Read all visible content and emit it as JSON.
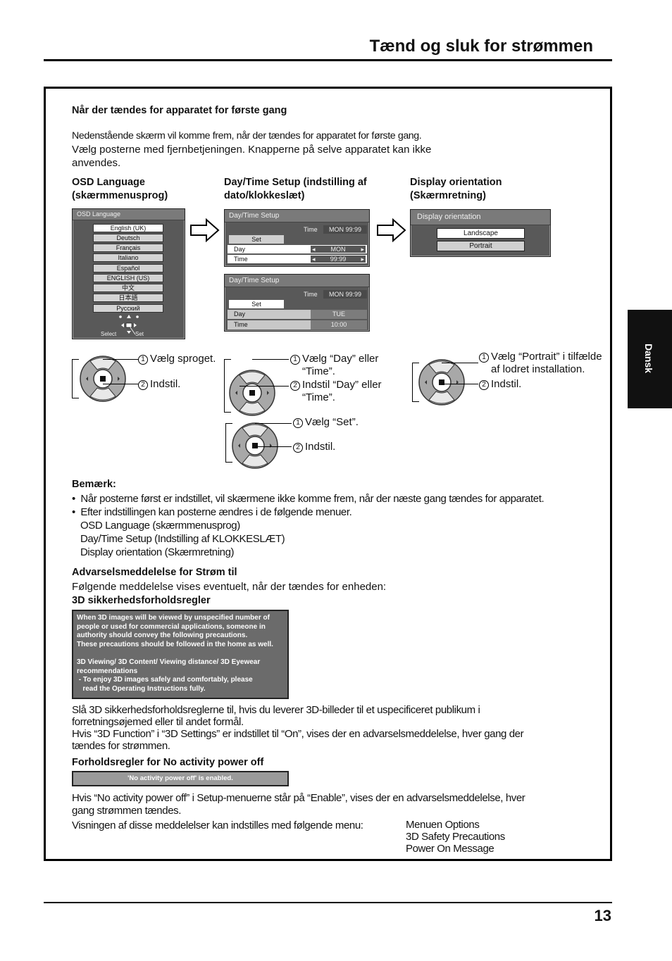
{
  "header": {
    "title": "Tænd og sluk for strømmen"
  },
  "side_tab": {
    "label": "Dansk"
  },
  "page_number": "13",
  "first_power_on": {
    "heading": "Når der tændes for apparatet for første gang",
    "intro_line1": "Nedenstående skærm vil komme frem, når der tændes for apparatet for første gang.",
    "intro_line2": "Vælg posterne med fjernbetjeningen. Knapperne på selve apparatet kan ikke",
    "intro_line3": "anvendes.",
    "columns": [
      {
        "title_line1": "OSD Language",
        "title_line2": "(skærmmenusprog)"
      },
      {
        "title_line1": "Day/Time Setup (indstilling af",
        "title_line2": "dato/klokkeslæt)"
      },
      {
        "title_line1": "Display orientation",
        "title_line2": "(Skærmretning)"
      }
    ]
  },
  "osd_language_screen": {
    "title": "OSD Language",
    "languages": [
      "English (UK)",
      "Deutsch",
      "Français",
      "Italiano",
      "Español",
      "ENGLISH (US)",
      "中文",
      "日本語",
      "Русский"
    ],
    "selected": "English (UK)",
    "select_label": "Select",
    "set_label": "Set"
  },
  "daytime_screen_1": {
    "title": "Day/Time Setup",
    "time_label": "Time",
    "time_value": "MON  99:99",
    "set_label": "Set",
    "day_label": "Day",
    "day_value": "MON",
    "time_row_label": "Time",
    "time_row_value": "99:99"
  },
  "daytime_screen_2": {
    "title": "Day/Time Setup",
    "time_label": "Time",
    "time_value": "MON  99:99",
    "set_label": "Set",
    "day_label": "Day",
    "day_value": "TUE",
    "time_row_label": "Time",
    "time_row_value": "10:00"
  },
  "orientation_screen": {
    "title": "Display orientation",
    "options": [
      "Landscape",
      "Portrait"
    ],
    "selected": "Landscape"
  },
  "instructions": {
    "osd": {
      "step1": "Vælg sproget.",
      "step2": "Indstil."
    },
    "daytime_a": {
      "step1_l1": "Vælg “Day” eller",
      "step1_l2": "“Time”.",
      "step2_l1": "Indstil “Day” eller",
      "step2_l2": "“Time”."
    },
    "daytime_b": {
      "step1": "Vælg “Set”.",
      "step2": "Indstil."
    },
    "orientation": {
      "step1_l1": "Vælg “Portrait” i tilfælde",
      "step1_l2": "af lodret installation.",
      "step2": "Indstil."
    },
    "num1": "1",
    "num2": "2"
  },
  "note": {
    "heading": "Bemærk:",
    "bullet1": "Når posterne først er indstillet, vil skærmene ikke komme frem, når der næste gang tændes for apparatet.",
    "bullet2": "Efter indstillingen kan posterne ændres i de følgende menuer.",
    "menu1": "OSD Language (skærmmenusprog)",
    "menu2": "Day/Time Setup (Indstilling af KLOKKESLÆT)",
    "menu3": "Display orientation (Skærmretning)"
  },
  "warning": {
    "heading": "Advarselsmeddelelse for Strøm til",
    "text": "Følgende meddelelse vises eventuelt, når der tændes for enheden:",
    "sub_heading": "3D sikkerhedsforholdsregler",
    "box_lines": [
      "When 3D images will be viewed by unspecified number of",
      "people or used for commercial applications, someone in",
      "authority should convey the following precautions.",
      "These precautions should be followed in the home as well.",
      "",
      "3D Viewing/ 3D Content/ Viewing distance/ 3D Eyewear",
      "recommendations",
      " - To enjoy 3D images safely and comfortably, please",
      "   read the Operating Instructions fully."
    ],
    "para1_l1": "Slå 3D sikkerhedsforholdsreglerne til, hvis du leverer 3D-billeder til et uspecificeret publikum i",
    "para1_l2": "forretningsøjemed eller til andet formål.",
    "para2_l1": "Hvis “3D Function” i “3D Settings” er indstillet til “On”, vises der en advarselsmeddelelse, hver gang der",
    "para2_l2": "tændes for strømmen."
  },
  "no_activity": {
    "heading": "Forholdsregler for No activity power off",
    "box_text": "'No activity power off' is enabled.",
    "para_l1": "Hvis “No activity power off” i Setup-menuerne står på “Enable”, vises der en advarselsmeddelelse, hver",
    "para_l2": "gang strømmen tændes.",
    "menu_lead": "Visningen af disse meddelelser kan indstilles med følgende menu:",
    "menu_items": [
      "Menuen Options",
      "3D Safety Precautions",
      "Power On Message"
    ]
  }
}
